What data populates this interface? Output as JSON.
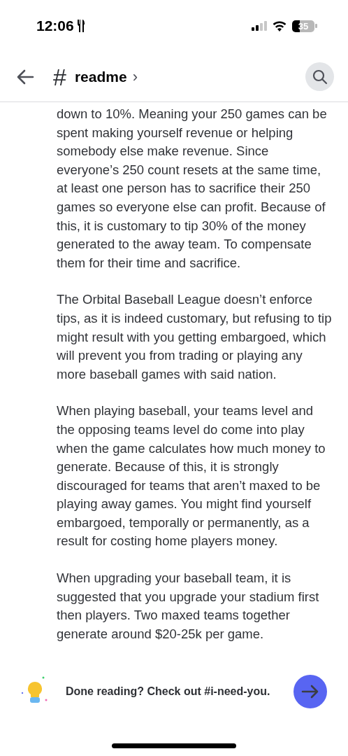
{
  "status_bar": {
    "time": "12:06",
    "battery": "35"
  },
  "header": {
    "hash": "#",
    "channel": "readme",
    "chevron": "›"
  },
  "paragraphs": [
    "down to 10%. Meaning your 250 games can be spent making yourself revenue or helping somebody else make revenue. Since everyone’s 250 count resets at the same time, at least one person has to sacrifice their 250 games so everyone else can profit. Because of this, it is customary to tip 30% of the money generated to the away team. To compensate them for their time and sacrifice.",
    "The Orbital Baseball League doesn’t enforce tips, as it is indeed customary, but refusing to tip might result with you getting embargoed, which will prevent you from trading or playing any more baseball games with said nation.",
    "When playing baseball, your teams level and the opposing teams level do come into play when the game calculates how much money to generate. Because of this, it is strongly discouraged for teams that aren’t maxed to be playing away games. You might find yourself embargoed, temporally or permanently, as a result for costing home players money.",
    "When upgrading your baseball team, it is suggested that you upgrade your stadium first then players. Two maxed teams together generate around $20-25k per game."
  ],
  "footer": {
    "prompt": "Done reading? Check out #i-need-you."
  }
}
